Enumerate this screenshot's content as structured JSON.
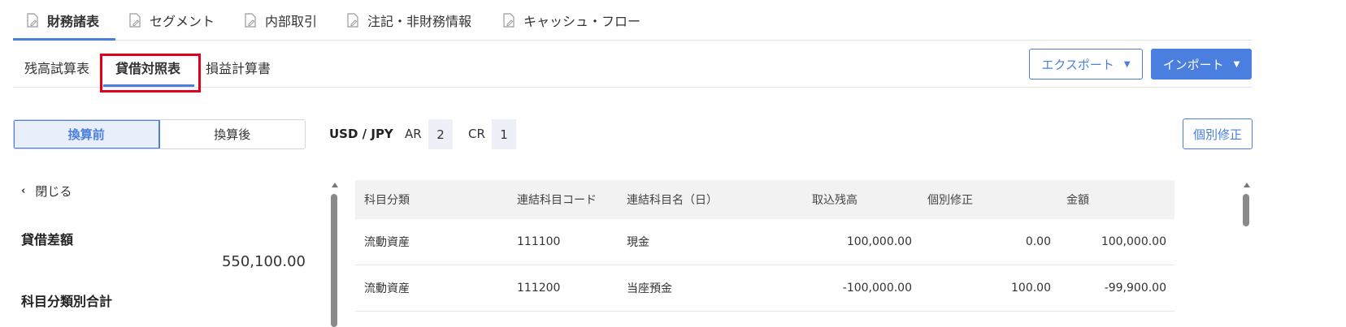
{
  "top_tabs": [
    {
      "label": "財務諸表",
      "active": true
    },
    {
      "label": "セグメント",
      "active": false
    },
    {
      "label": "内部取引",
      "active": false
    },
    {
      "label": "注記・非財務情報",
      "active": false
    },
    {
      "label": "キャッシュ・フロー",
      "active": false
    }
  ],
  "sub_tabs": [
    {
      "label": "残高試算表",
      "active": false
    },
    {
      "label": "貸借対照表",
      "active": true
    },
    {
      "label": "損益計算書",
      "active": false
    }
  ],
  "actions": {
    "export_label": "エクスポート",
    "import_label": "インポート",
    "individual_fix_label": "個別修正"
  },
  "toggle": {
    "before_label": "換算前",
    "after_label": "換算後",
    "selected": "換算前"
  },
  "rates": {
    "pair": "USD / JPY",
    "ar_label": "AR",
    "ar_value": "2",
    "cr_label": "CR",
    "cr_value": "1"
  },
  "left_panel": {
    "close_label": "閉じる",
    "diff_title": "貸借差額",
    "diff_value": "550,100.00",
    "category_total_title": "科目分類別合計"
  },
  "table": {
    "headers": [
      "科目分類",
      "連結科目コード",
      "連結科目名（日）",
      "取込残高",
      "個別修正",
      "金額"
    ],
    "rows": [
      [
        "流動資産",
        "111100",
        "現金",
        "100,000.00",
        "0.00",
        "100,000.00"
      ],
      [
        "流動資産",
        "111200",
        "当座預金",
        "-100,000.00",
        "100.00",
        "-99,900.00"
      ]
    ]
  },
  "colors": {
    "accent": "#4a7fe0",
    "highlight_border": "#e0001b"
  },
  "icons": {
    "tab_icon": "document-edit-icon",
    "dropdown_icon": "caret-down-icon",
    "close_icon": "chevron-left-icon"
  }
}
